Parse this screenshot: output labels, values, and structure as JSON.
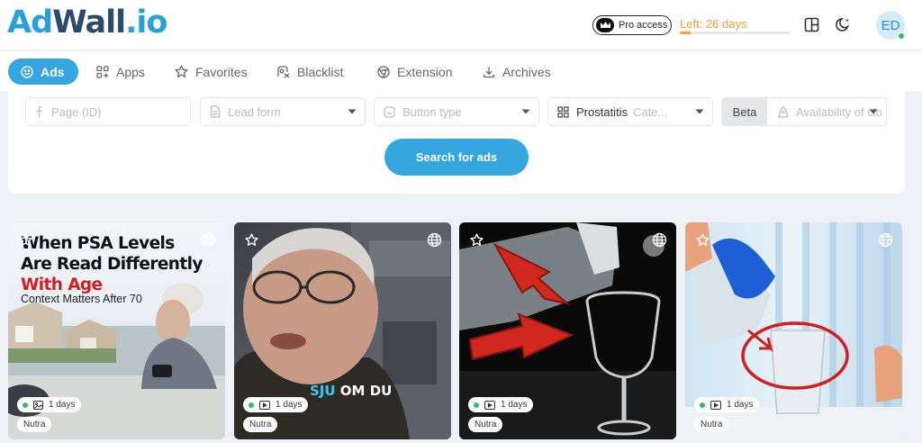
{
  "logo": {
    "part1": "Ad",
    "part2": "Wall",
    "part3": ".io"
  },
  "header": {
    "pro_label": "Pro access",
    "left_days": "Left: 26 days",
    "trial_progress": 0.1,
    "avatar_initials": "ED"
  },
  "tabs": [
    {
      "label": "Ads",
      "icon": "smile-icon",
      "active": true
    },
    {
      "label": "Apps",
      "icon": "apps-grid-icon",
      "active": false
    },
    {
      "label": "Favorites",
      "icon": "star-icon",
      "active": false
    },
    {
      "label": "Blacklist",
      "icon": "blacklist-icon",
      "active": false
    },
    {
      "label": "Extension",
      "icon": "chrome-icon",
      "active": false
    },
    {
      "label": "Archives",
      "icon": "download-icon",
      "active": false
    }
  ],
  "filters": {
    "page_placeholder": "Page (ID)",
    "lead_form_placeholder": "Lead form",
    "button_type_placeholder": "Button type",
    "category_value": "Prostatitis",
    "category_placeholder": "Cate...",
    "beta_label": "Beta",
    "availability_placeholder": "Availability of clo"
  },
  "search_button": "Search for ads",
  "cards": [
    {
      "headline_line1": "When PSA Levels",
      "headline_line2": "Are Read Differently",
      "headline_line3": "With Age",
      "subheadline": "Context Matters After 70",
      "days": "1 days",
      "media": "image",
      "tag": "Nutra"
    },
    {
      "caption_part1": "SJU",
      "caption_part2": " OM DU",
      "days": "1 days",
      "media": "video",
      "tag": "Nutra"
    },
    {
      "days": "1 days",
      "media": "video",
      "tag": "Nutra"
    },
    {
      "days": "1 days",
      "media": "video",
      "tag": "Nutra"
    }
  ],
  "colors": {
    "accent": "#36a6e0",
    "logo_blue": "#2a9fd8",
    "logo_dark": "#2c4a6b",
    "warning": "#f0a23a",
    "status_green": "#2bbf6a",
    "headline_red": "#d11f1f"
  }
}
